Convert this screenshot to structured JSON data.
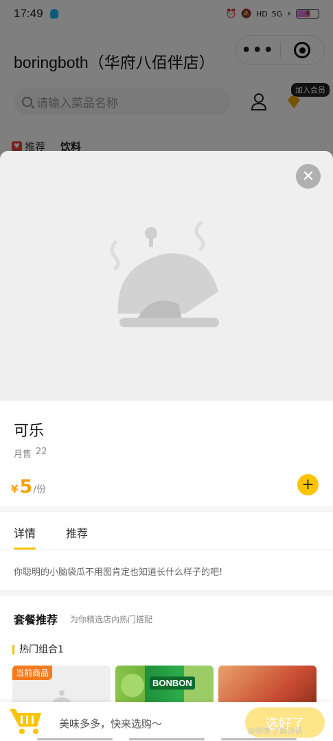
{
  "status_bar": {
    "time": "17:49",
    "icons": [
      "alarm-icon",
      "mute-icon",
      "hd-icon",
      "signal-icon",
      "charging-icon"
    ],
    "hd": "HD",
    "signal": "5G",
    "battery_label": "4"
  },
  "header": {
    "store_title": "boringboth（华府八佰伴店）",
    "capsule_more": "•••",
    "search_placeholder": "请输入菜品名称",
    "member_badge": "加入会员",
    "tabs": [
      {
        "label": "推荐",
        "icon": "heart-icon"
      },
      {
        "label": "饮料"
      }
    ]
  },
  "modal": {
    "close": "✕",
    "product": {
      "name": "可乐",
      "monthly_label": "月售",
      "monthly_value": "22",
      "currency": "¥",
      "price": "5",
      "unit": "/份",
      "add": "+"
    },
    "detail_tabs": [
      {
        "label": "详情",
        "active": true
      },
      {
        "label": "推荐",
        "active": false
      }
    ],
    "description": "你聪明的小脑袋瓜不用图肯定也知道长什么样子的吧!",
    "combo": {
      "title": "套餐推荐",
      "subtitle": "为你精选店内热门搭配",
      "group_title": "热门组合1",
      "current_badge": "当前商品",
      "drink_brand": "BONBON"
    }
  },
  "bottom_bar": {
    "text": "美味多多，快来选购〜",
    "button": "选好了",
    "watermark": "@微博 了解详情"
  },
  "colors": {
    "accent": "#fcc400",
    "price": "#f5a200",
    "badge": "#f37b1d"
  }
}
